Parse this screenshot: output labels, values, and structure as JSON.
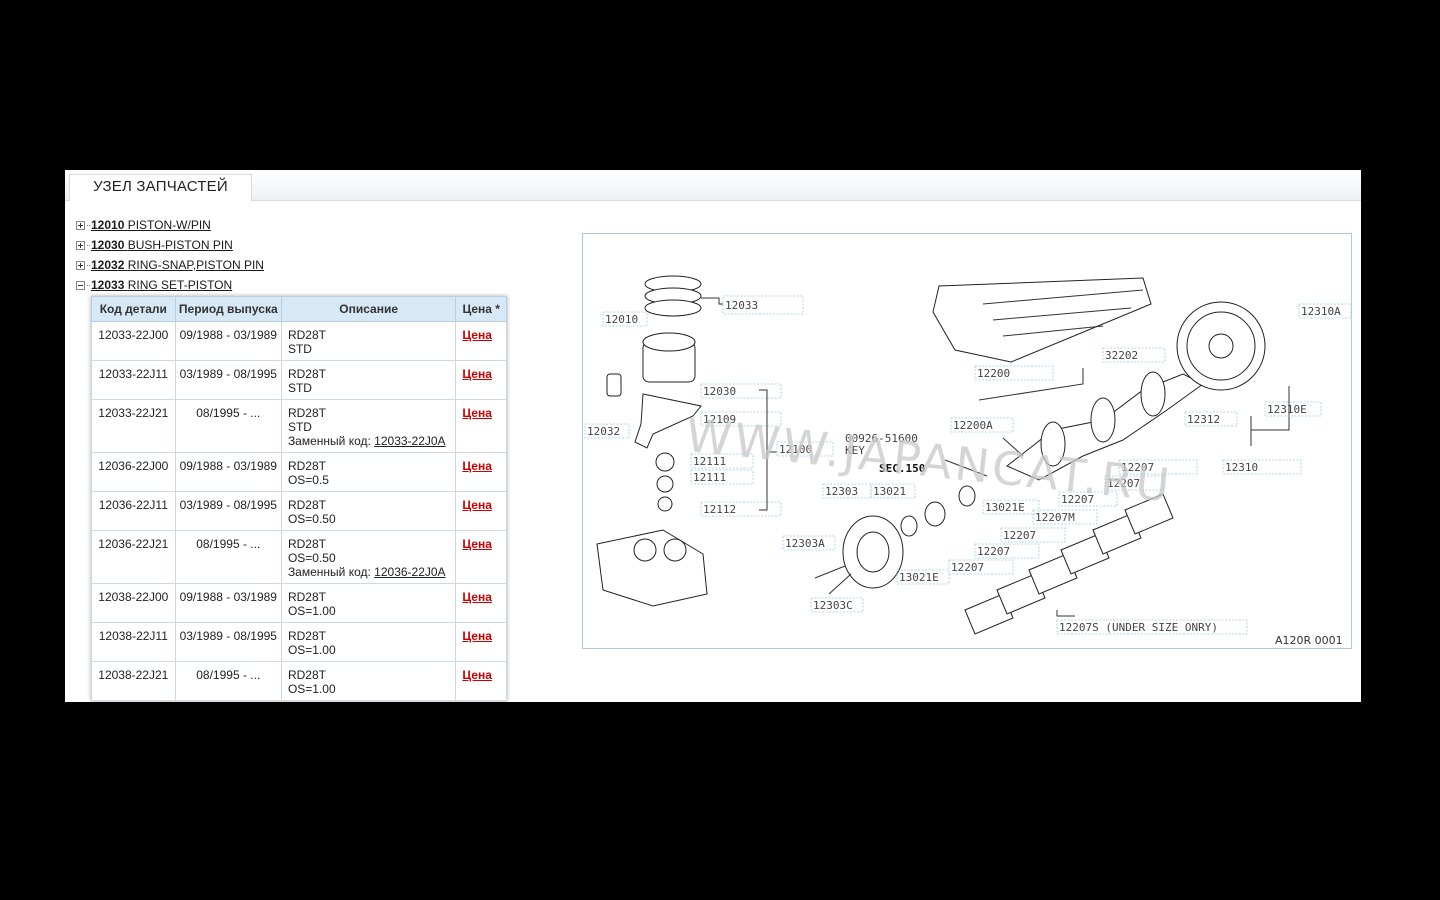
{
  "tab": {
    "title": "УЗЕЛ ЗАПЧАСТЕЙ"
  },
  "tree": [
    {
      "code": "12010",
      "name": "PISTON-W/PIN",
      "expanded": false
    },
    {
      "code": "12030",
      "name": "BUSH-PISTON PIN",
      "expanded": false
    },
    {
      "code": "12032",
      "name": "RING-SNAP,PISTON PIN",
      "expanded": false
    },
    {
      "code": "12033",
      "name": "RING SET-PISTON",
      "expanded": true
    }
  ],
  "table": {
    "headers": {
      "code": "Код детали",
      "period": "Период выпуска",
      "description": "Описание",
      "price": "Цена *"
    },
    "rows": [
      {
        "code": "12033-22J00",
        "period": "09/1988 - 03/1989",
        "desc1": "RD28T",
        "desc2": "STD",
        "price": "Цена"
      },
      {
        "code": "12033-22J11",
        "period": "03/1989 - 08/1995",
        "desc1": "RD28T",
        "desc2": "STD",
        "price": "Цена"
      },
      {
        "code": "12033-22J21",
        "period": "08/1995 - ...",
        "desc1": "RD28T",
        "desc2": "STD",
        "repl_label": "Заменный код: ",
        "repl_code": "12033-22J0A",
        "price": "Цена"
      },
      {
        "code": "12036-22J00",
        "period": "09/1988 - 03/1989",
        "desc1": "RD28T",
        "desc2": "OS=0.5",
        "price": "Цена"
      },
      {
        "code": "12036-22J11",
        "period": "03/1989 - 08/1995",
        "desc1": "RD28T",
        "desc2": "OS=0.50",
        "price": "Цена"
      },
      {
        "code": "12036-22J21",
        "period": "08/1995 - ...",
        "desc1": "RD28T",
        "desc2": "OS=0.50",
        "repl_label": "Заменный код: ",
        "repl_code": "12036-22J0A",
        "price": "Цена"
      },
      {
        "code": "12038-22J00",
        "period": "09/1988 - 03/1989",
        "desc1": "RD28T",
        "desc2": "OS=1.00",
        "price": "Цена"
      },
      {
        "code": "12038-22J11",
        "period": "03/1989 - 08/1995",
        "desc1": "RD28T",
        "desc2": "OS=1.00",
        "price": "Цена"
      },
      {
        "code": "12038-22J21",
        "period": "08/1995 - ...",
        "desc1": "RD28T",
        "desc2": "OS=1.00",
        "price": "Цена"
      }
    ]
  },
  "diagram": {
    "watermark": "WWW.JAPANCAT.RU",
    "figure_code": "A120R 0001",
    "callouts": [
      "12033",
      "12010",
      "12032",
      "12030",
      "12109",
      "12100",
      "12111",
      "12111",
      "12112",
      "12200",
      "12200A",
      "32202",
      "12310A",
      "12312",
      "12310E",
      "12310",
      "00926-51600",
      "KEY",
      "SEC.150",
      "13021",
      "13021E",
      "12303",
      "12303A",
      "12303C",
      "13021E",
      "12207",
      "12207",
      "12207",
      "12207M",
      "12207",
      "12207",
      "12207",
      "12207S (UNDER SIZE ONRY)"
    ]
  }
}
